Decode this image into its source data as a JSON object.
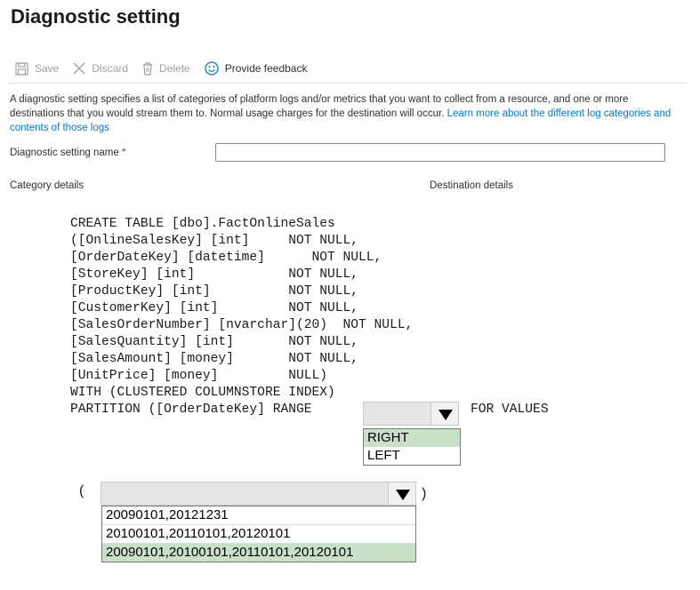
{
  "page": {
    "title": "Diagnostic setting"
  },
  "toolbar": {
    "save": "Save",
    "discard": "Discard",
    "delete": "Delete",
    "feedback": "Provide feedback"
  },
  "description": {
    "text": "A diagnostic setting specifies a list of categories of platform logs and/or metrics that you want to collect from a resource, and one or more destinations that you would stream them to. Normal usage charges for the destination will occur. ",
    "link": "Learn more about the different log categories and contents of those logs"
  },
  "form": {
    "name_label": "Diagnostic setting name",
    "required_mark": "*",
    "name_value": "",
    "category_details": "Category details",
    "destination_details": "Destination details"
  },
  "code": {
    "lines": [
      "CREATE TABLE [dbo].FactOnlineSales",
      "([OnlineSalesKey] [int]     NOT NULL,",
      "[OrderDateKey] [datetime]      NOT NULL,",
      "[StoreKey] [int]            NOT NULL,",
      "[ProductKey] [int]          NOT NULL,",
      "[CustomerKey] [int]         NOT NULL,",
      "[SalesOrderNumber] [nvarchar](20)  NOT NULL,",
      "[SalesQuantity] [int]       NOT NULL,",
      "[SalesAmount] [money]       NOT NULL,",
      "[UnitPrice] [money]         NULL)",
      "WITH (CLUSTERED COLUMNSTORE INDEX)",
      "PARTITION ([OrderDateKey] RANGE"
    ],
    "for_values": "FOR VALUES",
    "paren_open": "(",
    "paren_close": ")"
  },
  "range_dropdown": {
    "selected": "",
    "options": [
      "RIGHT",
      "LEFT"
    ],
    "highlighted_index": 0
  },
  "values_dropdown": {
    "selected": "",
    "options": [
      "20090101,20121231",
      "20100101,20110101,20120101",
      "20090101,20100101,20110101,20120101"
    ],
    "highlighted_index": 2
  },
  "colors": {
    "link": "#0078d4",
    "highlight": "#c9e0c9",
    "required": "#a4262c"
  }
}
